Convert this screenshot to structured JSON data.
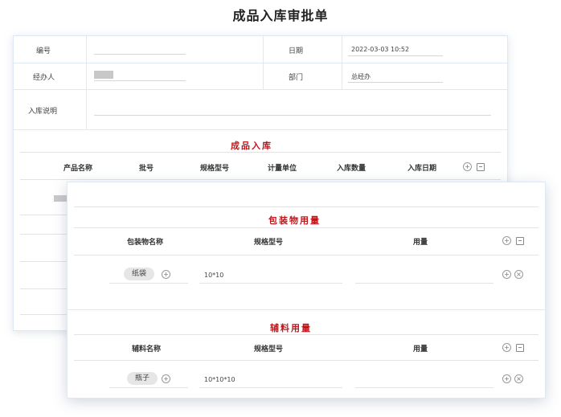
{
  "page": {
    "title": "成品入库审批单"
  },
  "form": {
    "number_label": "编号",
    "date_label": "日期",
    "date_value": "2022-03-03 10:52",
    "handler_label": "经办人",
    "dept_label": "部门",
    "dept_value": "总经办",
    "note_label": "入库说明"
  },
  "product_section": {
    "title": "成品入库",
    "columns": [
      "产品名称",
      "批号",
      "规格型号",
      "计量单位",
      "入库数量",
      "入库日期"
    ]
  },
  "packaging_section": {
    "title": "包装物用量",
    "columns": [
      "包装物名称",
      "规格型号",
      "用量"
    ],
    "rows": [
      {
        "name": "纸袋",
        "spec": "10*10",
        "qty": ""
      }
    ]
  },
  "aux_section": {
    "title": "辅料用量",
    "columns": [
      "辅料名称",
      "规格型号",
      "用量"
    ],
    "rows": [
      {
        "name": "瓶子",
        "spec": "10*10*10",
        "qty": ""
      }
    ]
  },
  "icons": {
    "add": "plus-circle-icon",
    "remove": "close-circle-icon",
    "import": "import-icon"
  }
}
